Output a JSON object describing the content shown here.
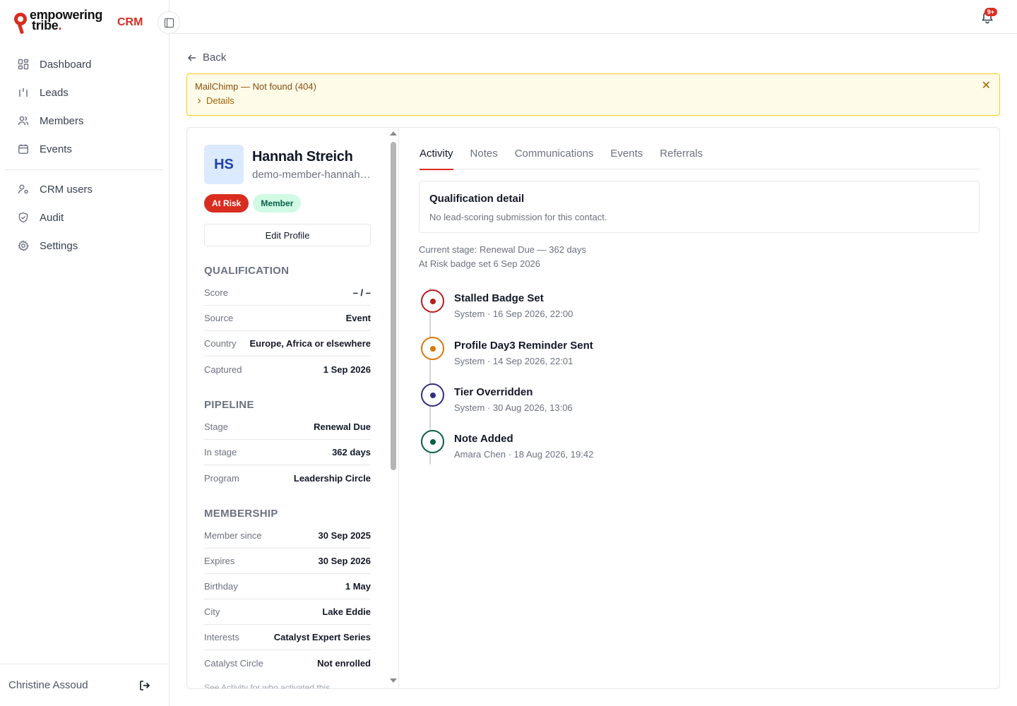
{
  "brand": {
    "line1": "empowering",
    "line2": "tribe",
    "line2_dot": ".",
    "crm": "CRM"
  },
  "sidebar": {
    "primary": [
      {
        "label": "Dashboard",
        "icon": "dashboard-icon"
      },
      {
        "label": "Leads",
        "icon": "leads-icon"
      },
      {
        "label": "Members",
        "icon": "members-icon"
      },
      {
        "label": "Events",
        "icon": "calendar-icon"
      }
    ],
    "secondary": [
      {
        "label": "CRM users",
        "icon": "crm-users-icon"
      },
      {
        "label": "Audit",
        "icon": "shield-icon"
      },
      {
        "label": "Settings",
        "icon": "gear-icon"
      }
    ],
    "user_name": "Christine Assoud"
  },
  "topbar": {
    "notification_count": "9+"
  },
  "back_label": "Back",
  "alert": {
    "message": "MailChimp — Not found (404)",
    "details_label": "Details",
    "close": "✕"
  },
  "profile": {
    "initials": "HS",
    "name": "Hannah Streich",
    "slug": "demo-member-hannah-streich",
    "tags": [
      "At Risk",
      "Member"
    ],
    "edit_label": "Edit Profile"
  },
  "qualification": {
    "title": "QUALIFICATION",
    "rows": [
      {
        "k": "Score",
        "v": "– / –"
      },
      {
        "k": "Source",
        "v": "Event"
      },
      {
        "k": "Country",
        "v": "Europe, Africa or elsewhere"
      },
      {
        "k": "Captured",
        "v": "1 Sep 2026"
      }
    ]
  },
  "pipeline": {
    "title": "PIPELINE",
    "rows": [
      {
        "k": "Stage",
        "v": "Renewal Due"
      },
      {
        "k": "In stage",
        "v": "362 days"
      },
      {
        "k": "Program",
        "v": "Leadership Circle"
      }
    ]
  },
  "membership": {
    "title": "MEMBERSHIP",
    "rows": [
      {
        "k": "Member since",
        "v": "30 Sep 2025"
      },
      {
        "k": "Expires",
        "v": "30 Sep 2026"
      },
      {
        "k": "Birthday",
        "v": "1 May"
      },
      {
        "k": "City",
        "v": "Lake Eddie"
      },
      {
        "k": "Interests",
        "v": "Catalyst Expert Series"
      },
      {
        "k": "Catalyst Circle",
        "v": "Not enrolled"
      }
    ],
    "note": "See Activity for who activated this"
  },
  "tabs": [
    "Activity",
    "Notes",
    "Communications",
    "Events",
    "Referrals"
  ],
  "qualification_detail": {
    "title": "Qualification detail",
    "text": "No lead-scoring submission for this contact."
  },
  "meta": {
    "stage_line": "Current stage: Renewal Due — 362 days",
    "badge_line": "At Risk badge set 6 Sep 2026"
  },
  "timeline": [
    {
      "title": "Stalled Badge Set",
      "sub": "System · 16 Sep 2026, 22:00",
      "color": "#b91c1c"
    },
    {
      "title": "Profile Day3 Reminder Sent",
      "sub": "System · 14 Sep 2026, 22:01",
      "color": "#d97706"
    },
    {
      "title": "Tier Overridden",
      "sub": "System · 30 Aug 2026, 13:06",
      "color": "#312e81"
    },
    {
      "title": "Note Added",
      "sub": "Amara Chen · 18 Aug 2026, 19:42",
      "color": "#065f46"
    }
  ]
}
